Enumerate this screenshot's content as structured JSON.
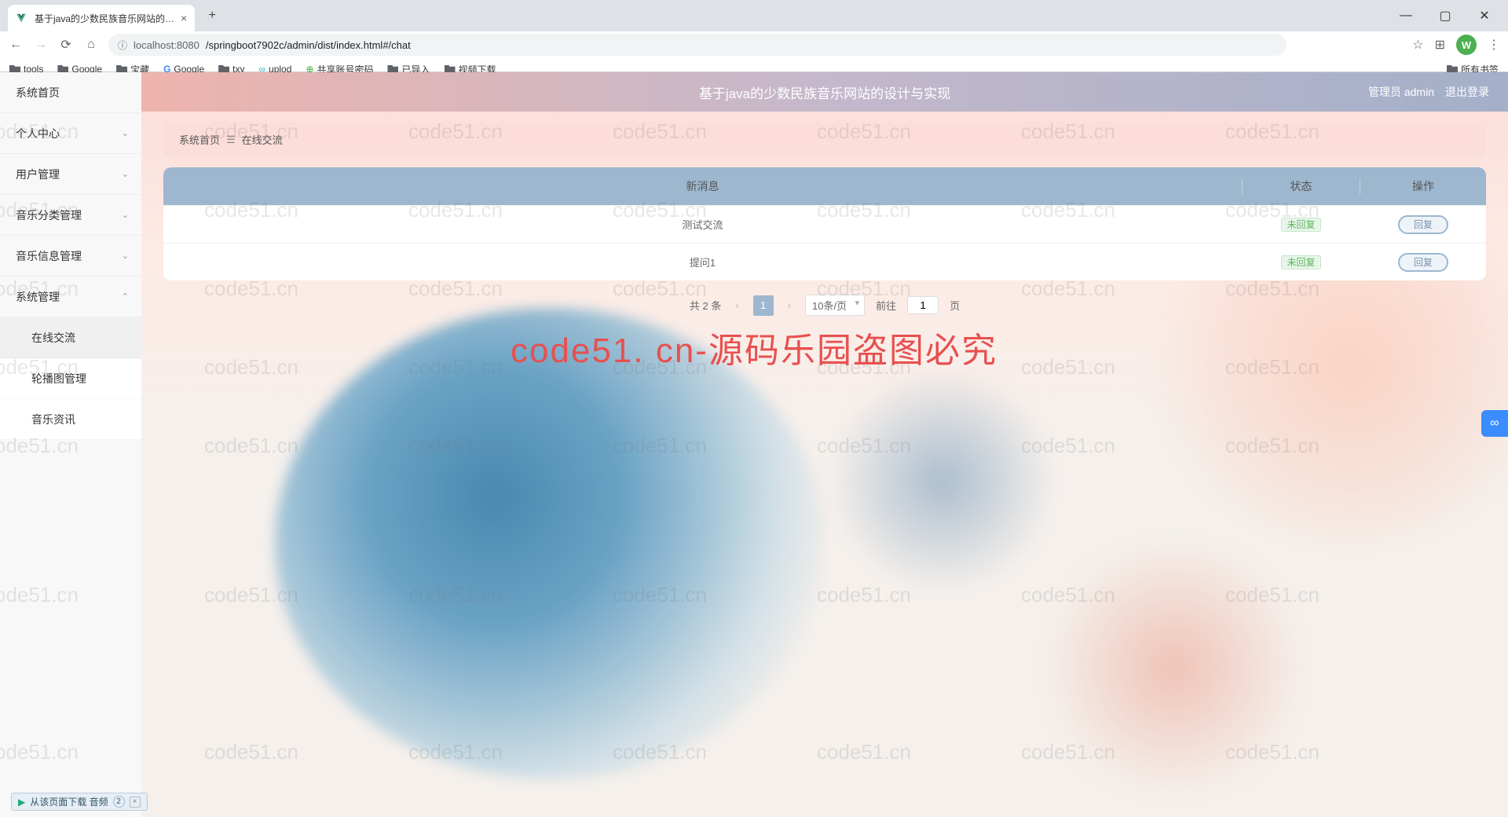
{
  "browser": {
    "tab_title": "基于java的少数民族音乐网站的…",
    "url_host": "localhost:8080",
    "url_path": "/springboot7902c/admin/dist/index.html#/chat",
    "avatar_letter": "W"
  },
  "bookmarks": {
    "items": [
      "tools",
      "Google",
      "宝藏",
      "Google",
      "txy",
      "uplod",
      "共享账号密码",
      "已导入",
      "视频下载"
    ],
    "all": "所有书签"
  },
  "header": {
    "title": "基于java的少数民族音乐网站的设计与实现",
    "role": "管理员 admin",
    "logout": "退出登录"
  },
  "sidebar": {
    "items": [
      {
        "label": "系统首页",
        "arrow": false
      },
      {
        "label": "个人中心",
        "arrow": true
      },
      {
        "label": "用户管理",
        "arrow": true
      },
      {
        "label": "音乐分类管理",
        "arrow": true
      },
      {
        "label": "音乐信息管理",
        "arrow": true
      },
      {
        "label": "系统管理",
        "arrow": true,
        "expanded": true
      },
      {
        "label": "在线交流",
        "sub": true,
        "active": true
      },
      {
        "label": "轮播图管理",
        "sub": true
      },
      {
        "label": "音乐资讯",
        "sub": true
      }
    ]
  },
  "breadcrumb": {
    "home": "系统首页",
    "current": "在线交流"
  },
  "table": {
    "headers": {
      "msg": "新消息",
      "status": "状态",
      "action": "操作"
    },
    "rows": [
      {
        "msg": "测试交流",
        "status": "未回复",
        "action": "回复"
      },
      {
        "msg": "提问1",
        "status": "未回复",
        "action": "回复"
      }
    ]
  },
  "pagination": {
    "total": "共 2 条",
    "page": "1",
    "size": "10条/页",
    "goto_prefix": "前往",
    "goto_value": "1",
    "goto_suffix": "页"
  },
  "watermark_text": "code51.cn",
  "big_watermark": "code51. cn-源码乐园盗图必究",
  "status_bar": {
    "text": "从该页面下载 音频",
    "count": "2"
  }
}
